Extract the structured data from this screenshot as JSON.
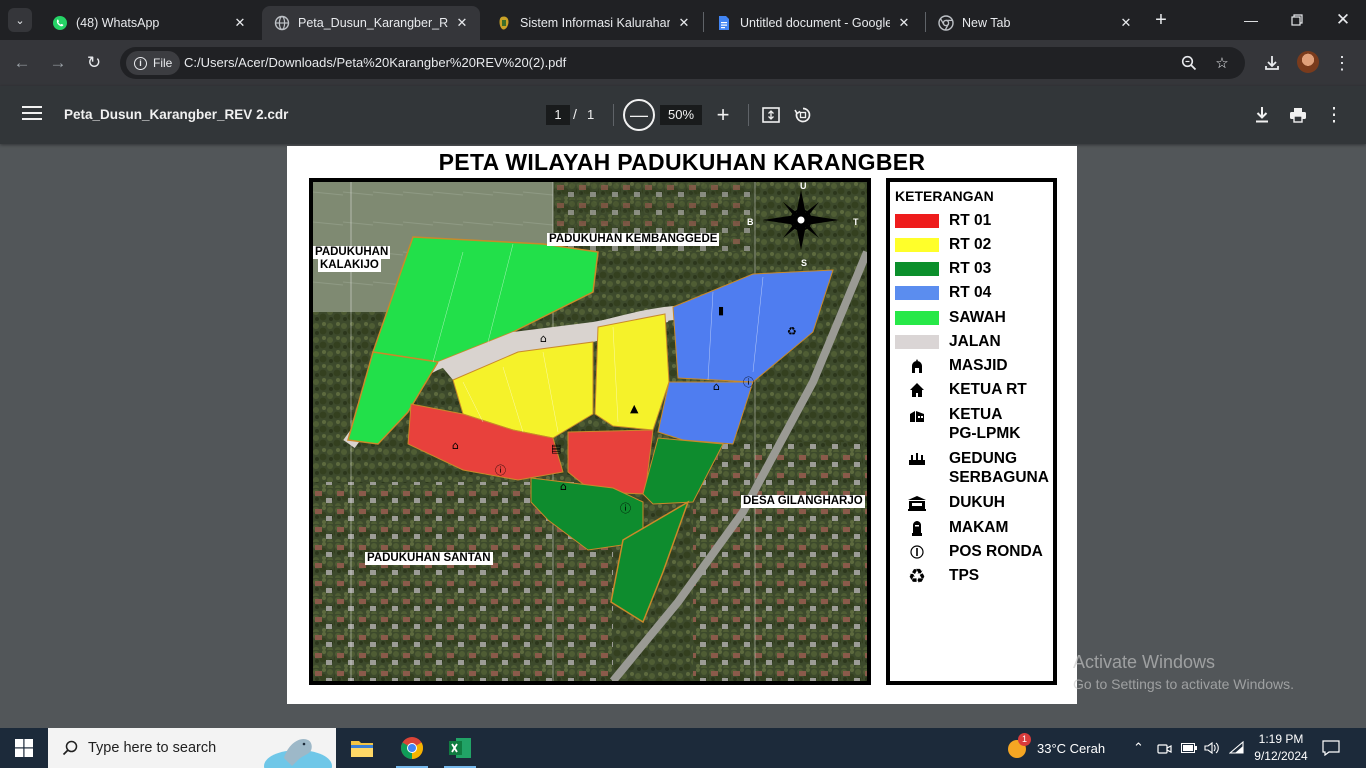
{
  "tabs": [
    {
      "title": "(48) WhatsApp",
      "icon": "whatsapp-icon",
      "active": false
    },
    {
      "title": "Peta_Dusun_Karangber_REV",
      "icon": "globe-icon",
      "active": true
    },
    {
      "title": "Sistem Informasi Kalurahan",
      "icon": "site-logo-icon",
      "active": false
    },
    {
      "title": "Untitled document - Google",
      "icon": "docs-icon",
      "active": false
    },
    {
      "title": "New Tab",
      "icon": "chrome-icon",
      "active": false
    }
  ],
  "toolbar": {
    "chip_label": "File",
    "url": "C:/Users/Acer/Downloads/Peta%20Karangber%20REV%20(2).pdf"
  },
  "pdf_viewer": {
    "file_title": "Peta_Dusun_Karangber_REV 2.cdr",
    "current_page": "1",
    "page_separator": "/",
    "total_pages": "1",
    "zoom": "50%"
  },
  "map": {
    "title": "PETA WILAYAH PADUKUHAN KARANGBER",
    "compass": {
      "n": "U",
      "s": "S",
      "e": "T",
      "w": "B"
    },
    "area_labels": {
      "kembanggede": "PADUKUHAN KEMBANGGEDE",
      "kalakijo_1": "PADUKUHAN",
      "kalakijo_2": "KALAKIJO",
      "gilangharjo": "DESA GILANGHARJO",
      "santan": "PADUKUHAN SANTAN"
    },
    "region_colors": {
      "rt01": "#e8413c",
      "rt02": "#f5f22a",
      "rt03": "#0e8c2e",
      "rt04": "#4f7df0",
      "sawah": "#22e04a",
      "jalan": "#d9d3cf"
    }
  },
  "legend": {
    "heading": "KETERANGAN",
    "swatches": [
      {
        "label": "RT 01",
        "color": "#ee1c1c"
      },
      {
        "label": "RT 02",
        "color": "#ffff2a"
      },
      {
        "label": "RT 03",
        "color": "#0b8f2b"
      },
      {
        "label": "RT 04",
        "color": "#5b8def"
      },
      {
        "label": "SAWAH",
        "color": "#27e848"
      },
      {
        "label": "JALAN",
        "color": "#dad5d5"
      }
    ],
    "symbols": [
      {
        "label": "MASJID",
        "icon": "mosque-icon"
      },
      {
        "label": "KETUA RT",
        "icon": "house-icon"
      },
      {
        "label_1": "KETUA",
        "label_2": "PG-LPMK",
        "icon": "office-icon"
      },
      {
        "label_1": "GEDUNG",
        "label_2": "SERBAGUNA",
        "icon": "hall-icon"
      },
      {
        "label": "DUKUH",
        "icon": "dukuh-building-icon"
      },
      {
        "label": "MAKAM",
        "icon": "grave-icon"
      },
      {
        "label": "POS RONDA",
        "icon": "guard-post-icon"
      },
      {
        "label": "TPS",
        "icon": "recycle-icon"
      }
    ]
  },
  "watermark": {
    "line1": "Activate Windows",
    "line2": "Go to Settings to activate Windows."
  },
  "taskbar": {
    "search_placeholder": "Type here to search",
    "weather": "33°C  Cerah",
    "notification_count": "1",
    "time": "1:19 PM",
    "date": "9/12/2024"
  }
}
